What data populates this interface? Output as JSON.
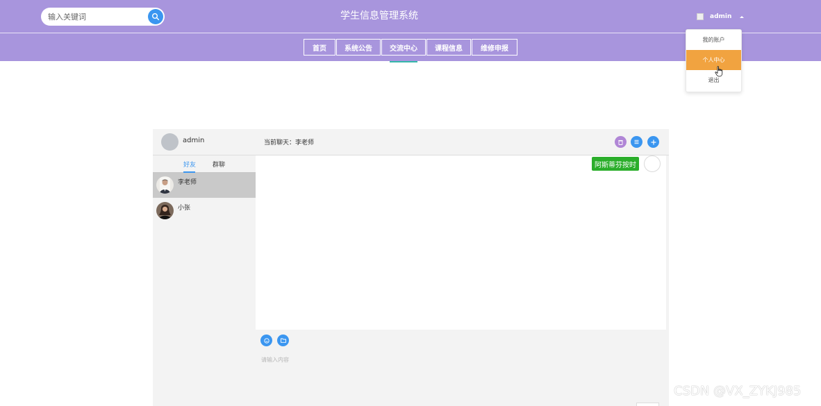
{
  "header": {
    "title": "学生信息管理系统",
    "search_placeholder": "输入关键词",
    "username": "admin"
  },
  "nav": {
    "items": [
      "首页",
      "系统公告",
      "交流中心",
      "课程信息",
      "维修申报"
    ],
    "active": "交流中心"
  },
  "user_menu": {
    "items": [
      "我的账户",
      "个人中心",
      "退出"
    ],
    "highlighted": "个人中心"
  },
  "chat": {
    "me": "admin",
    "current_chat_label": "当前聊天：李老师",
    "tabs": [
      "好友",
      "群聊"
    ],
    "friends": [
      {
        "name": "李老师",
        "selected": true
      },
      {
        "name": "小张",
        "selected": false
      }
    ],
    "message_text": "阿斯蒂芬按时",
    "input_placeholder": "请输入内容"
  },
  "colors": {
    "header_bg": "#a895dd",
    "accent_blue": "#3b96f0",
    "dropdown_highlight": "#f1a340",
    "bubble_green": "#2bae2b",
    "nav_active_underline": "#35b7aa"
  },
  "watermark": "CSDN @VX_ZYKJ985"
}
